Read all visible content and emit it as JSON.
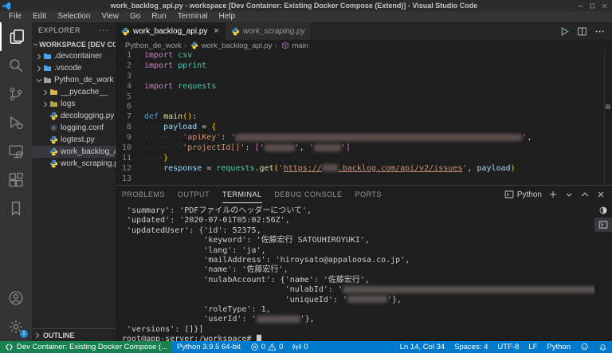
{
  "window": {
    "title": "work_backlog_api.py - workspace [Dev Container: Existing Docker Compose (Extend)] - Visual Studio Code",
    "controls": [
      {
        "name": "minimize-button",
        "icon": "minimize-icon"
      },
      {
        "name": "maximize-button",
        "icon": "maximize-icon"
      },
      {
        "name": "close-button",
        "icon": "window-close-icon"
      }
    ]
  },
  "menu_bar": {
    "items": [
      "File",
      "Edit",
      "Selection",
      "View",
      "Go",
      "Run",
      "Terminal",
      "Help"
    ]
  },
  "activity_bar": {
    "top": [
      {
        "name": "explorer",
        "icon": "files-icon",
        "active": true
      },
      {
        "name": "search",
        "icon": "search-icon"
      },
      {
        "name": "source-control",
        "icon": "source-control-icon"
      },
      {
        "name": "run-and-debug",
        "icon": "run-debug-icon"
      },
      {
        "name": "remote-explorer",
        "icon": "remote-explorer-icon"
      },
      {
        "name": "extensions",
        "icon": "extensions-icon"
      },
      {
        "name": "bookmarks",
        "icon": "bookmarks-icon"
      }
    ],
    "bottom": [
      {
        "name": "accounts",
        "icon": "account-icon"
      },
      {
        "name": "settings",
        "icon": "settings-gear-icon",
        "badge": "1"
      }
    ]
  },
  "sidebar": {
    "title": "EXPLORER",
    "actions_label": "···",
    "workspace": {
      "label": "WORKSPACE [DEV CONTAIN...",
      "chevron": "down"
    },
    "tree": [
      {
        "label": ".devcontainer",
        "icon": "folder-icon",
        "color": "#42a5f5",
        "chevron": "right",
        "depth": 0
      },
      {
        "label": ".vscode",
        "icon": "folder-icon",
        "color": "#42a5f5",
        "chevron": "right",
        "depth": 0
      },
      {
        "label": "Python_de_work",
        "icon": "folder-icon",
        "color": "#90a4ae",
        "chevron": "down",
        "depth": 0
      },
      {
        "label": "__pycache__",
        "icon": "folder-icon",
        "color": "#d9b44a",
        "chevron": "right",
        "depth": 1
      },
      {
        "label": "logs",
        "icon": "folder-icon",
        "color": "#b5a642",
        "chevron": "right",
        "depth": 1
      },
      {
        "label": "decologging.py",
        "icon": "python-icon",
        "depth": 1
      },
      {
        "label": "logging.conf",
        "icon": "gear-file-icon",
        "depth": 1
      },
      {
        "label": "logtest.py",
        "icon": "python-icon",
        "depth": 1
      },
      {
        "label": "work_backlog_a...",
        "icon": "python-icon",
        "depth": 1,
        "selected": true
      },
      {
        "label": "work_scraping.py",
        "icon": "python-icon",
        "depth": 1
      }
    ],
    "outline": {
      "label": "OUTLINE",
      "chevron": "right"
    }
  },
  "editor": {
    "tabs": [
      {
        "label": "work_backlog_api.py",
        "icon": "python-icon",
        "active": true,
        "close_label": "×"
      },
      {
        "label": "work_scraping.py",
        "icon": "python-icon",
        "active": false
      }
    ],
    "actions": [
      {
        "name": "run-python-file-button",
        "icon": "play-icon",
        "cls": "run"
      },
      {
        "name": "split-editor-button",
        "icon": "split-editor-icon"
      },
      {
        "name": "more-actions-button",
        "icon": "more-icon"
      }
    ],
    "breadcrumb": [
      {
        "label": "Python_de_work"
      },
      {
        "label": "work_backlog_api.py",
        "icon": "python-icon"
      },
      {
        "label": "main",
        "icon": "symbol-method-icon"
      }
    ],
    "code_lines": [
      {
        "n": "1",
        "tokens": [
          {
            "t": "import",
            "c": "kw"
          },
          {
            "t": " ",
            "c": "pn"
          },
          {
            "t": "csv",
            "c": "mod"
          }
        ]
      },
      {
        "n": "2",
        "tokens": [
          {
            "t": "import",
            "c": "kw"
          },
          {
            "t": " ",
            "c": "pn"
          },
          {
            "t": "pprint",
            "c": "mod"
          }
        ]
      },
      {
        "n": "3",
        "tokens": []
      },
      {
        "n": "4",
        "tokens": [
          {
            "t": "import",
            "c": "kw"
          },
          {
            "t": " ",
            "c": "pn"
          },
          {
            "t": "requests",
            "c": "mod"
          }
        ]
      },
      {
        "n": "5",
        "tokens": []
      },
      {
        "n": "6",
        "tokens": []
      },
      {
        "n": "7",
        "tokens": [
          {
            "t": "def",
            "c": "kw2"
          },
          {
            "t": " ",
            "c": "pn"
          },
          {
            "t": "main",
            "c": "fn"
          },
          {
            "t": "()",
            "c": "br1"
          },
          {
            "t": ":",
            "c": "pn"
          }
        ]
      },
      {
        "n": "8",
        "tokens": [
          {
            "t": "    ",
            "c": "ws"
          },
          {
            "t": "payload",
            "c": "var"
          },
          {
            "t": " = ",
            "c": "pn"
          },
          {
            "t": "{",
            "c": "br1"
          }
        ]
      },
      {
        "n": "9",
        "tokens": [
          {
            "t": "        ",
            "c": "ws"
          },
          {
            "t": "'apiKey'",
            "c": "str"
          },
          {
            "t": ": ",
            "c": "pn"
          },
          {
            "t": "'",
            "c": "str"
          },
          {
            "r": 360
          },
          {
            "t": "'",
            "c": "str"
          },
          {
            "t": ",",
            "c": "pn"
          }
        ]
      },
      {
        "n": "10",
        "tokens": [
          {
            "t": "        ",
            "c": "ws"
          },
          {
            "t": "'projectId[]'",
            "c": "str"
          },
          {
            "t": ": ",
            "c": "pn"
          },
          {
            "t": "[",
            "c": "br2"
          },
          {
            "t": "'",
            "c": "str"
          },
          {
            "r": 38
          },
          {
            "t": "'",
            "c": "str"
          },
          {
            "t": ", ",
            "c": "pn"
          },
          {
            "t": "'",
            "c": "str"
          },
          {
            "r": 34
          },
          {
            "t": "'",
            "c": "str"
          },
          {
            "t": "]",
            "c": "br2"
          }
        ]
      },
      {
        "n": "11",
        "tokens": [
          {
            "t": "    ",
            "c": "ws"
          },
          {
            "t": "}",
            "c": "br1"
          }
        ]
      },
      {
        "n": "12",
        "tokens": [
          {
            "t": "    ",
            "c": "ws"
          },
          {
            "t": "response",
            "c": "var"
          },
          {
            "t": " = ",
            "c": "pn"
          },
          {
            "t": "requests",
            "c": "mod"
          },
          {
            "t": ".",
            "c": "pn"
          },
          {
            "t": "get",
            "c": "fn"
          },
          {
            "t": "(",
            "c": "br1"
          },
          {
            "t": "'",
            "c": "str"
          },
          {
            "t": "https://",
            "c": "str lnk"
          },
          {
            "r": 20,
            "lnk": true
          },
          {
            "t": ".backlog.com/api/v2/issues",
            "c": "str lnk"
          },
          {
            "t": "'",
            "c": "str"
          },
          {
            "t": ", ",
            "c": "pn"
          },
          {
            "t": "payload",
            "c": "var"
          },
          {
            "t": ")",
            "c": "br1"
          }
        ]
      },
      {
        "n": "13",
        "tokens": []
      }
    ]
  },
  "panel": {
    "tabs": [
      {
        "label": "PROBLEMS"
      },
      {
        "label": "OUTPUT"
      },
      {
        "label": "TERMINAL",
        "active": true
      },
      {
        "label": "DEBUG CONSOLE"
      },
      {
        "label": "PORTS"
      }
    ],
    "shell_label": "Python",
    "actions": [
      {
        "name": "new-terminal-button",
        "icon": "plus-icon"
      },
      {
        "name": "terminal-dropdown-button",
        "icon": "chevron-down-small-icon"
      },
      {
        "name": "maximize-panel-button",
        "icon": "chevron-up-icon"
      },
      {
        "name": "close-panel-button",
        "icon": "close-icon"
      }
    ],
    "terminal_lines": [
      {
        "segs": [
          {
            "t": " 'summary': 'PDFファイルのヘッダーについて',"
          }
        ]
      },
      {
        "segs": [
          {
            "t": " 'updated': '2020-07-01T05:02:56Z',"
          }
        ]
      },
      {
        "segs": [
          {
            "t": " 'updatedUser': {'id': 52375,"
          }
        ]
      },
      {
        "segs": [
          {
            "t": "                 'keyword': '佐藤宏行 SATOUHIROYUKI',"
          }
        ]
      },
      {
        "segs": [
          {
            "t": "                 'lang': 'ja',"
          }
        ]
      },
      {
        "segs": [
          {
            "t": "                 'mailAddress': 'hiroysato@appaloosa.co.jp',"
          }
        ]
      },
      {
        "segs": [
          {
            "t": "                 'name': '佐藤宏行',"
          }
        ]
      },
      {
        "segs": [
          {
            "t": "                 'nulabAccount': {'name': '佐藤宏行',"
          }
        ]
      },
      {
        "segs": [
          {
            "t": "                                  'nulabId': '"
          },
          {
            "r": 320
          }
        ]
      },
      {
        "segs": [
          {
            "t": "                                  'uniqueId': '"
          },
          {
            "r": 50
          },
          {
            "t": "'},"
          }
        ]
      },
      {
        "segs": [
          {
            "t": "                 'roleType': 1,"
          }
        ]
      },
      {
        "segs": [
          {
            "t": "                 'userId': '"
          },
          {
            "r": 55
          },
          {
            "t": "'},"
          }
        ]
      },
      {
        "segs": [
          {
            "t": " 'versions': []}]"
          }
        ]
      }
    ],
    "prompt": "root@app-server:/workspace# ",
    "terminal_list": [
      {
        "name": "terminal-python",
        "icon": "half-circle-icon"
      },
      {
        "name": "terminal-bash",
        "icon": "terminal-box-icon",
        "selected": true
      }
    ]
  },
  "status_bar": {
    "remote": {
      "label": "Dev Container: Existing Docker Compose (...",
      "icon": "remote-icon",
      "bg": "#17824f"
    },
    "left_items": [
      {
        "name": "python-interpreter",
        "label": "Python 3.9.5 64-bit"
      },
      {
        "name": "problems",
        "parts": [
          {
            "icon": "error-icon",
            "label": "0"
          },
          {
            "icon": "warning-icon",
            "label": "0"
          }
        ]
      },
      {
        "name": "forwarded-ports",
        "parts": [
          {
            "icon": "broadcast-icon",
            "label": "0"
          }
        ]
      }
    ],
    "right_items": [
      {
        "name": "cursor-position",
        "label": "Ln 14, Col 34"
      },
      {
        "name": "indentation",
        "label": "Spaces: 4"
      },
      {
        "name": "encoding",
        "label": "UTF-8"
      },
      {
        "name": "eol",
        "label": "LF"
      },
      {
        "name": "language-mode",
        "label": "Python"
      },
      {
        "name": "feedback",
        "icon": "feedback-icon"
      },
      {
        "name": "notifications",
        "icon": "bell-icon"
      }
    ]
  },
  "colors": {
    "accent": "#007acc",
    "remote_green": "#17824f",
    "editor_bg": "#1e1e1e"
  }
}
